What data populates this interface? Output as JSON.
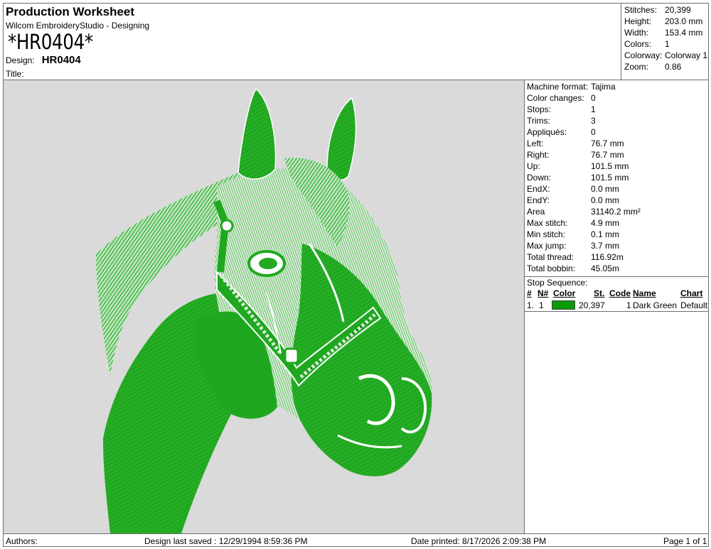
{
  "header": {
    "title": "Production Worksheet",
    "app": "Wilcom EmbroideryStudio - Designing",
    "code": "*HR0404*",
    "design_label": "Design:",
    "design_value": "HR0404",
    "title_label": "Title:"
  },
  "summary": [
    {
      "k": "Stitches:",
      "v": "20,399"
    },
    {
      "k": "Height:",
      "v": "203.0 mm"
    },
    {
      "k": "Width:",
      "v": "153.4 mm"
    },
    {
      "k": "Colors:",
      "v": "1"
    },
    {
      "k": "Colorway:",
      "v": "Colorway 1"
    },
    {
      "k": "Zoom:",
      "v": "0.86"
    }
  ],
  "details": [
    {
      "k": "Machine format:",
      "v": "Tajima"
    },
    {
      "k": "Color changes:",
      "v": "0"
    },
    {
      "k": "Stops:",
      "v": "1"
    },
    {
      "k": "Trims:",
      "v": "3"
    },
    {
      "k": "Appliqués:",
      "v": "0"
    },
    {
      "k": "Left:",
      "v": "76.7 mm"
    },
    {
      "k": "Right:",
      "v": "76.7 mm"
    },
    {
      "k": "Up:",
      "v": "101.5 mm"
    },
    {
      "k": "Down:",
      "v": "101.5 mm"
    },
    {
      "k": "EndX:",
      "v": "0.0 mm"
    },
    {
      "k": "EndY:",
      "v": "0.0 mm"
    },
    {
      "k": "Area",
      "v": "31140.2 mm²"
    },
    {
      "k": "Max stitch:",
      "v": "4.9 mm"
    },
    {
      "k": "Min stitch:",
      "v": "0.1 mm"
    },
    {
      "k": "Max jump:",
      "v": "3.7 mm"
    },
    {
      "k": "Total thread:",
      "v": "116.92m"
    },
    {
      "k": "Total bobbin:",
      "v": "45.05m"
    }
  ],
  "stop_sequence": {
    "label": "Stop Sequence:",
    "headers": {
      "num": "#",
      "n": "N#",
      "color": "Color",
      "st": "St.",
      "code": "Code",
      "name": "Name",
      "chart": "Chart"
    },
    "row": {
      "num": "1.",
      "n": "1",
      "color_hex": "#0a9a0a",
      "st": "20,397",
      "code": "1",
      "name": "Dark Green",
      "chart": "Default"
    }
  },
  "preview": {
    "thread_color": "#1fa81f",
    "background": "#dadada",
    "icon": "horse-head-embroidery"
  },
  "footer": {
    "authors": "Authors:",
    "saved": "Design last saved : 12/29/1994 8:59:36 PM",
    "printed": "Date printed: 8/17/2026 2:09:38 PM",
    "page": "Page 1 of 1"
  }
}
